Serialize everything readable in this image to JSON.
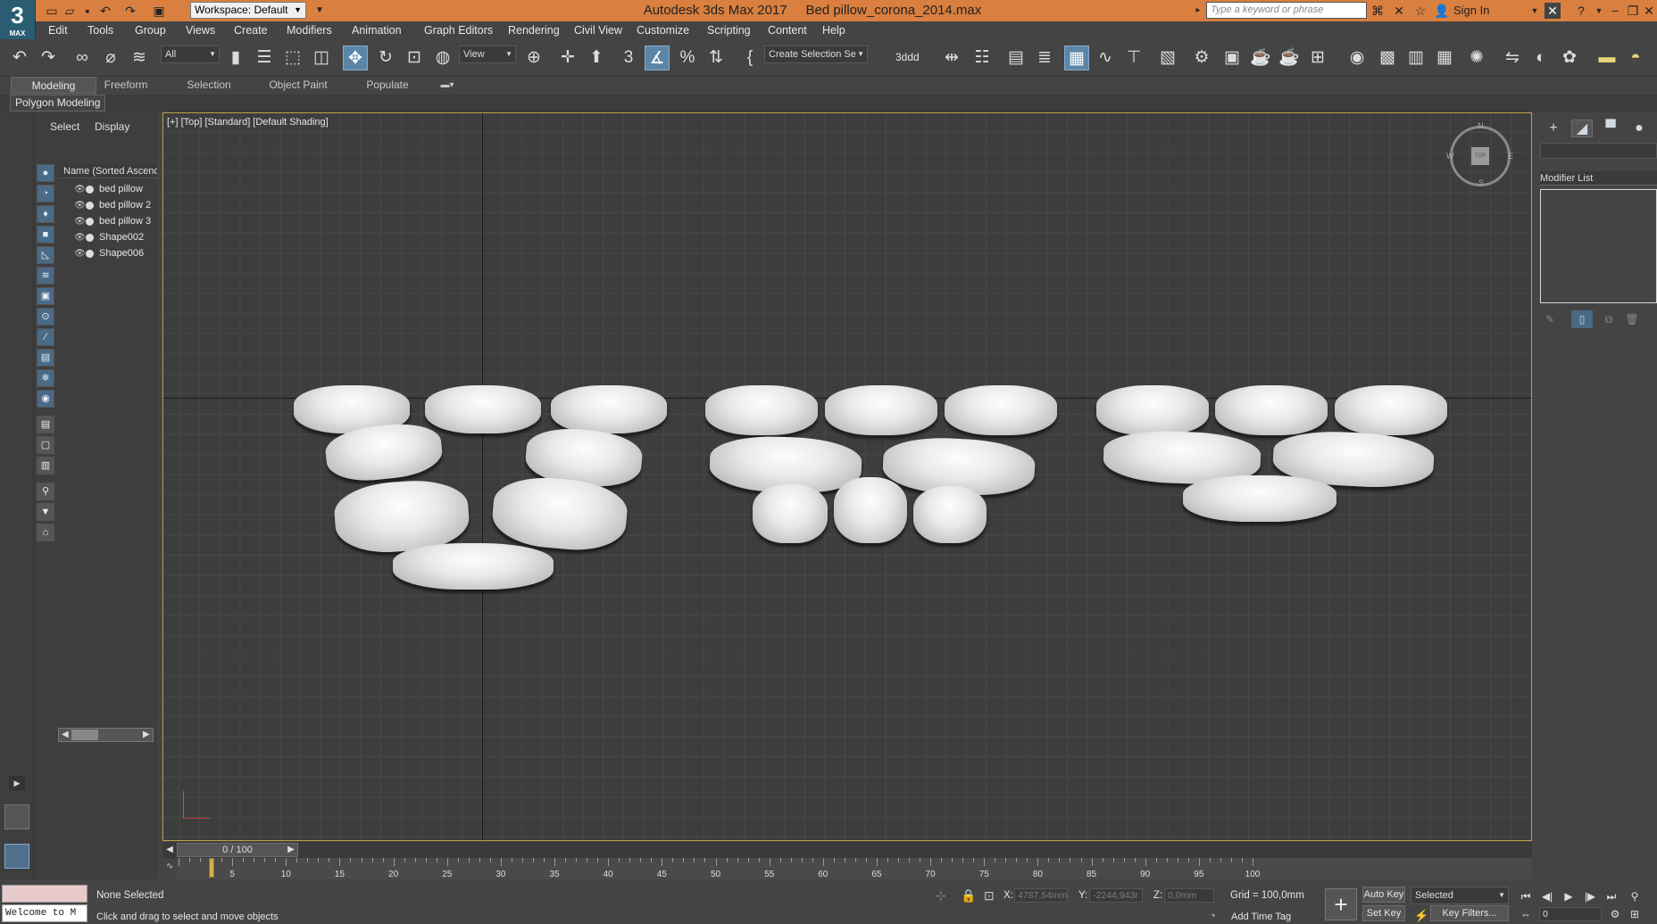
{
  "app": {
    "logo_text": "3",
    "logo_sub": "MAX",
    "title": "Autodesk 3ds Max 2017     Bed pillow_corona_2014.max"
  },
  "quick_access": {
    "workspace": "Workspace: Default"
  },
  "search": {
    "placeholder": "Type a keyword or phrase"
  },
  "account": {
    "signin": "Sign In"
  },
  "menu": [
    "Edit",
    "Tools",
    "Group",
    "Views",
    "Create",
    "Modifiers",
    "Animation",
    "Graph Editors",
    "Rendering",
    "Civil View",
    "Customize",
    "Scripting",
    "Content",
    "Help"
  ],
  "toolbar": {
    "filter": "All",
    "ref_coord": "View",
    "named_selection": "Create Selection Se",
    "snap_label": "3ddd"
  },
  "ribbon": {
    "tabs": [
      "Modeling",
      "Freeform",
      "Selection",
      "Object Paint",
      "Populate"
    ],
    "panel": "Polygon Modeling"
  },
  "scene_explorer": {
    "tabs": [
      "Select",
      "Display"
    ],
    "column": "Name (Sorted Ascend",
    "items": [
      "bed pillow",
      "bed pillow 2",
      "bed pillow 3",
      "Shape002",
      "Shape006"
    ]
  },
  "viewport": {
    "label": "[+] [Top] [Standard] [Default Shading]",
    "compass": {
      "n": "N",
      "s": "S",
      "e": "E",
      "w": "W",
      "center": "TOP"
    }
  },
  "command_panel": {
    "modifier_list": "Modifier List"
  },
  "timeline": {
    "frame": "0 / 100",
    "ticks": [
      "5",
      "10",
      "15",
      "20",
      "25",
      "30",
      "35",
      "40",
      "45",
      "50",
      "55",
      "60",
      "65",
      "70",
      "75",
      "80",
      "85",
      "90",
      "95",
      "100"
    ]
  },
  "status": {
    "maxscript": "Welcome to M",
    "selection": "None Selected",
    "prompt": "Click and drag to select and move objects",
    "x_label": "X:",
    "x_value": "4787,54mm",
    "y_label": "Y:",
    "y_value": "-2244,943r",
    "z_label": "Z:",
    "z_value": "0,0mm",
    "grid": "Grid = 100,0mm",
    "add_time_tag": "Add Time Tag",
    "auto_key": "Auto Key",
    "set_key": "Set Key",
    "key_mode": "Selected",
    "key_filters": "Key Filters...",
    "frame_field": "0"
  }
}
